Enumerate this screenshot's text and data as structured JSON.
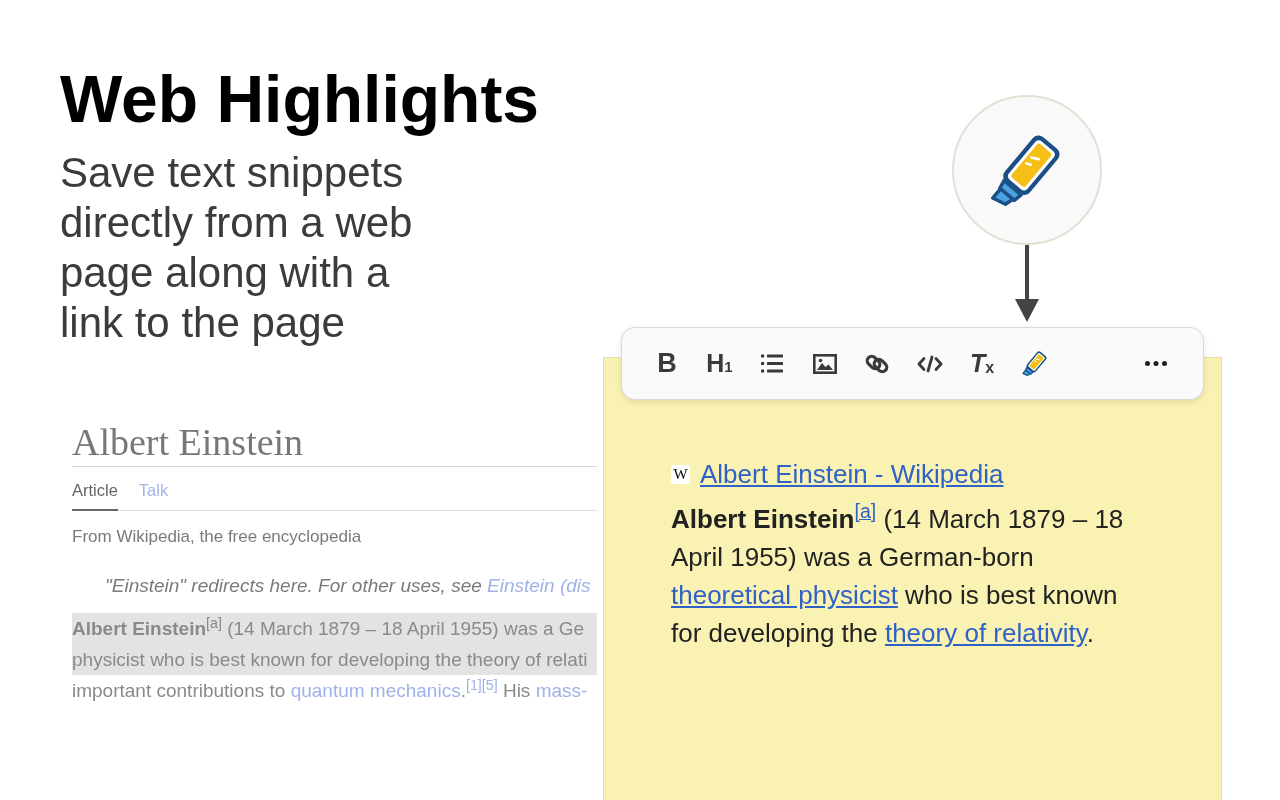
{
  "hero": {
    "title": "Web Highlights",
    "subtitle_lines": [
      "Save text snippets",
      "directly from a web",
      "page along with a",
      "link to the page"
    ]
  },
  "article": {
    "title": "Albert Einstein",
    "tabs": [
      {
        "label": "Article",
        "selected": true
      },
      {
        "label": "Talk",
        "selected": false
      }
    ],
    "tagline": "From Wikipedia, the free encyclopedia",
    "hatnote": [
      {
        "kind": "text",
        "text": "\"Einstein\" redirects here. For other uses, see "
      },
      {
        "kind": "link",
        "text": "Einstein (dis"
      }
    ],
    "lines": [
      {
        "highlighted": true,
        "segments": [
          {
            "kind": "text",
            "text": "**Albert Einstein**"
          },
          {
            "kind": "sup",
            "text": "[a]"
          },
          {
            "kind": "text",
            "text": " (14 March 1879 – 18 April 1955) was a Ge"
          }
        ]
      },
      {
        "highlighted": true,
        "segments": [
          {
            "kind": "text",
            "text": "physicist who is best known for developing the theory of relati"
          }
        ]
      },
      {
        "highlighted": false,
        "segments": [
          {
            "kind": "text",
            "text": "important contributions to "
          },
          {
            "kind": "link",
            "text": "quantum mechanics"
          },
          {
            "kind": "text",
            "text": "."
          },
          {
            "kind": "sup_link",
            "text": "[1][5]"
          },
          {
            "kind": "text",
            "text": " His "
          },
          {
            "kind": "link",
            "text": "mass-"
          }
        ]
      }
    ]
  },
  "toolbar": {
    "buttons": [
      {
        "kind": "bold",
        "label": "B"
      },
      {
        "kind": "heading",
        "label": "H$_{1}$"
      },
      {
        "kind": "list"
      },
      {
        "kind": "image"
      },
      {
        "kind": "link"
      },
      {
        "kind": "code"
      },
      {
        "kind": "clear_format",
        "label": "T$_{x}$"
      },
      {
        "kind": "highlight"
      },
      {
        "kind": "more"
      }
    ]
  },
  "note": {
    "source": {
      "icon_glyph": "W",
      "title": "Albert Einstein - Wikipedia"
    },
    "segments": [
      {
        "kind": "text",
        "text": "**Albert Einstein**"
      },
      {
        "kind": "sup_link",
        "text": "[a]"
      },
      {
        "kind": "text",
        "text": " (14 March 1879 – 18 April 1955) was a German-born "
      },
      {
        "kind": "link",
        "text": "theoretical physicist"
      },
      {
        "kind": "text",
        "text": " who is best known for developing the "
      },
      {
        "kind": "link",
        "text": "theory of relativity"
      },
      {
        "kind": "text",
        "text": "."
      }
    ]
  }
}
